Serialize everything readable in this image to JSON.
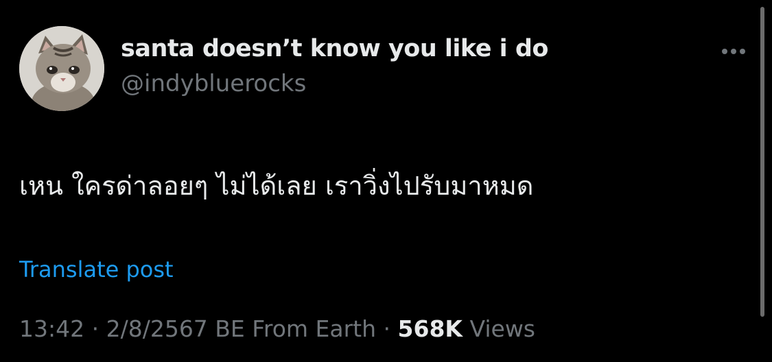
{
  "author": {
    "display_name": "santa doesn’t know you like i do",
    "handle": "@indybluerocks",
    "avatar_icon": "kitten-avatar"
  },
  "post": {
    "text": "เหน ใครด่าลอยๆ ไม่ได้เลย เราวิ่งไปรับมาหมด",
    "translate_label": "Translate post"
  },
  "meta": {
    "time": "13:42",
    "separator1": " · ",
    "date": "2/8/2567 BE",
    "source": "From Earth",
    "separator2": " · ",
    "views_count": "568K",
    "views_label": "Views"
  },
  "icons": {
    "more": "more-options-icon"
  },
  "colors": {
    "background": "#000000",
    "primary_text": "#e7e9ea",
    "secondary_text": "#71767b",
    "link": "#1d9bf0"
  }
}
